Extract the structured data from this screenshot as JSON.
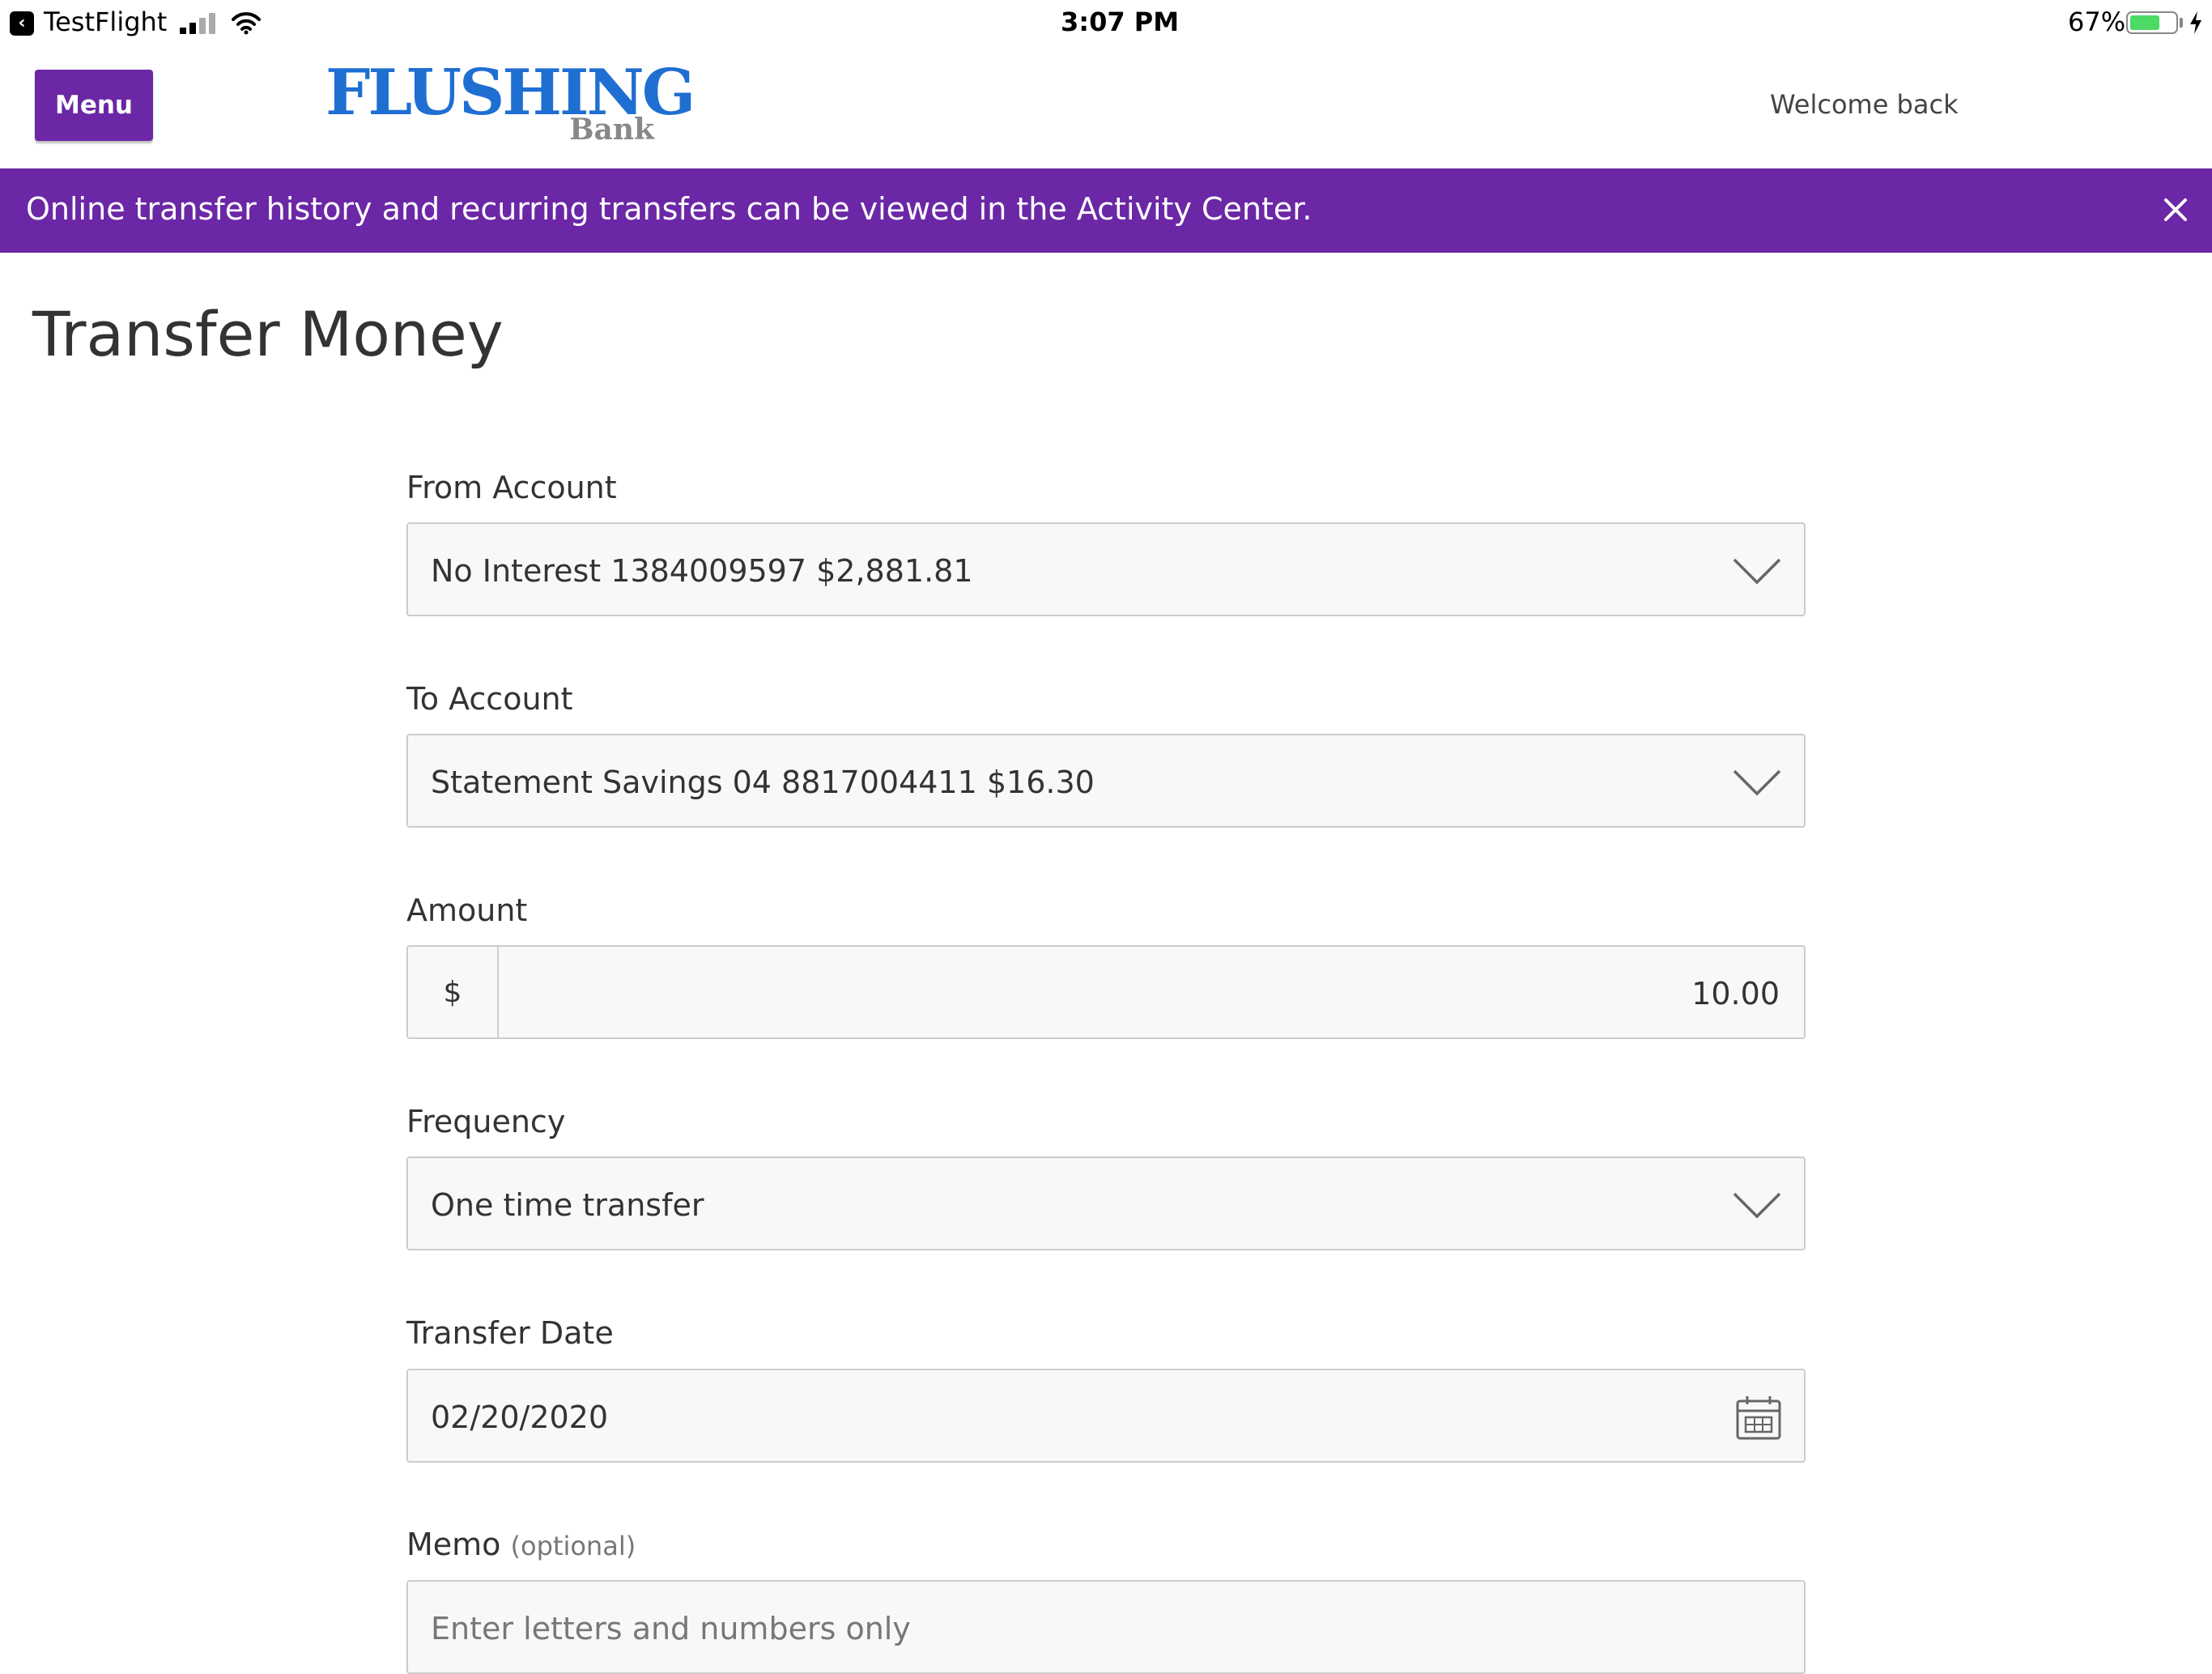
{
  "status_bar": {
    "app": "TestFlight",
    "time": "3:07 PM",
    "battery": "67%",
    "battery_level": 0.67
  },
  "header": {
    "menu_label": "Menu",
    "logo_main": "FLUSHING",
    "logo_sub": "Bank",
    "welcome": "Welcome back"
  },
  "banner": {
    "message": "Online transfer history and recurring transfers can be viewed in the Activity Center.",
    "close_icon": "close-icon"
  },
  "page": {
    "title": "Transfer Money"
  },
  "form": {
    "from_account": {
      "label": "From Account",
      "value": "No Interest 1384009597 $2,881.81"
    },
    "to_account": {
      "label": "To Account",
      "value": "Statement Savings 04 8817004411 $16.30"
    },
    "amount": {
      "label": "Amount",
      "prefix": "$",
      "value": "10.00"
    },
    "frequency": {
      "label": "Frequency",
      "value": "One time transfer"
    },
    "transfer_date": {
      "label": "Transfer Date",
      "value": "02/20/2020"
    },
    "memo": {
      "label": "Memo",
      "optional": "(optional)",
      "placeholder": "Enter letters and numbers only"
    }
  },
  "colors": {
    "brand_purple": "#6b27a6",
    "logo_blue": "#1f6fd2"
  }
}
